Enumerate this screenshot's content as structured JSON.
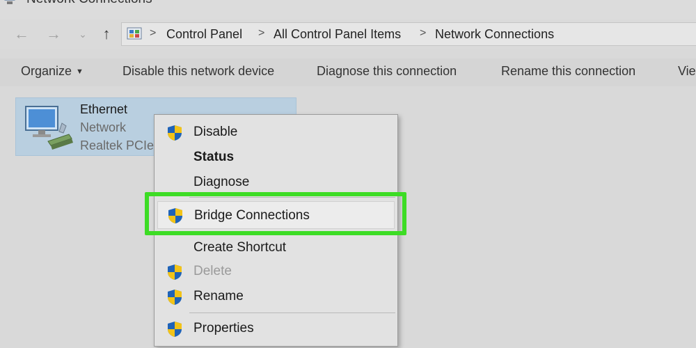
{
  "window": {
    "title": "Network Connections"
  },
  "address": {
    "crumbs": [
      "Control Panel",
      "All Control Panel Items",
      "Network Connections"
    ],
    "separator": ">"
  },
  "nav": {
    "back": "←",
    "forward": "→",
    "recent": "⌄",
    "up": "↑"
  },
  "commands": {
    "organize": "Organize",
    "disable_device": "Disable this network device",
    "diagnose": "Diagnose this connection",
    "rename": "Rename this connection",
    "view": "Vie"
  },
  "connection": {
    "name": "Ethernet",
    "status": "Network",
    "device": "Realtek PCIe"
  },
  "menu": {
    "items": [
      {
        "label": "Disable",
        "icon": "shield-icon",
        "style": "normal"
      },
      {
        "label": "Status",
        "icon": "",
        "style": "bold"
      },
      {
        "label": "Diagnose",
        "icon": "",
        "style": "normal"
      },
      {
        "label": "Bridge Connections",
        "icon": "shield-icon",
        "style": "highlighted"
      },
      {
        "label": "Create Shortcut",
        "icon": "",
        "style": "normal"
      },
      {
        "label": "Delete",
        "icon": "shield-icon",
        "style": "disabled"
      },
      {
        "label": "Rename",
        "icon": "shield-icon",
        "style": "normal"
      },
      {
        "label": "Properties",
        "icon": "shield-icon",
        "style": "normal"
      }
    ]
  },
  "colors": {
    "highlight_border": "#3ddc25",
    "selection": "#b9cfe0",
    "shield_blue": "#1f63b8",
    "shield_yellow": "#f2c318"
  }
}
